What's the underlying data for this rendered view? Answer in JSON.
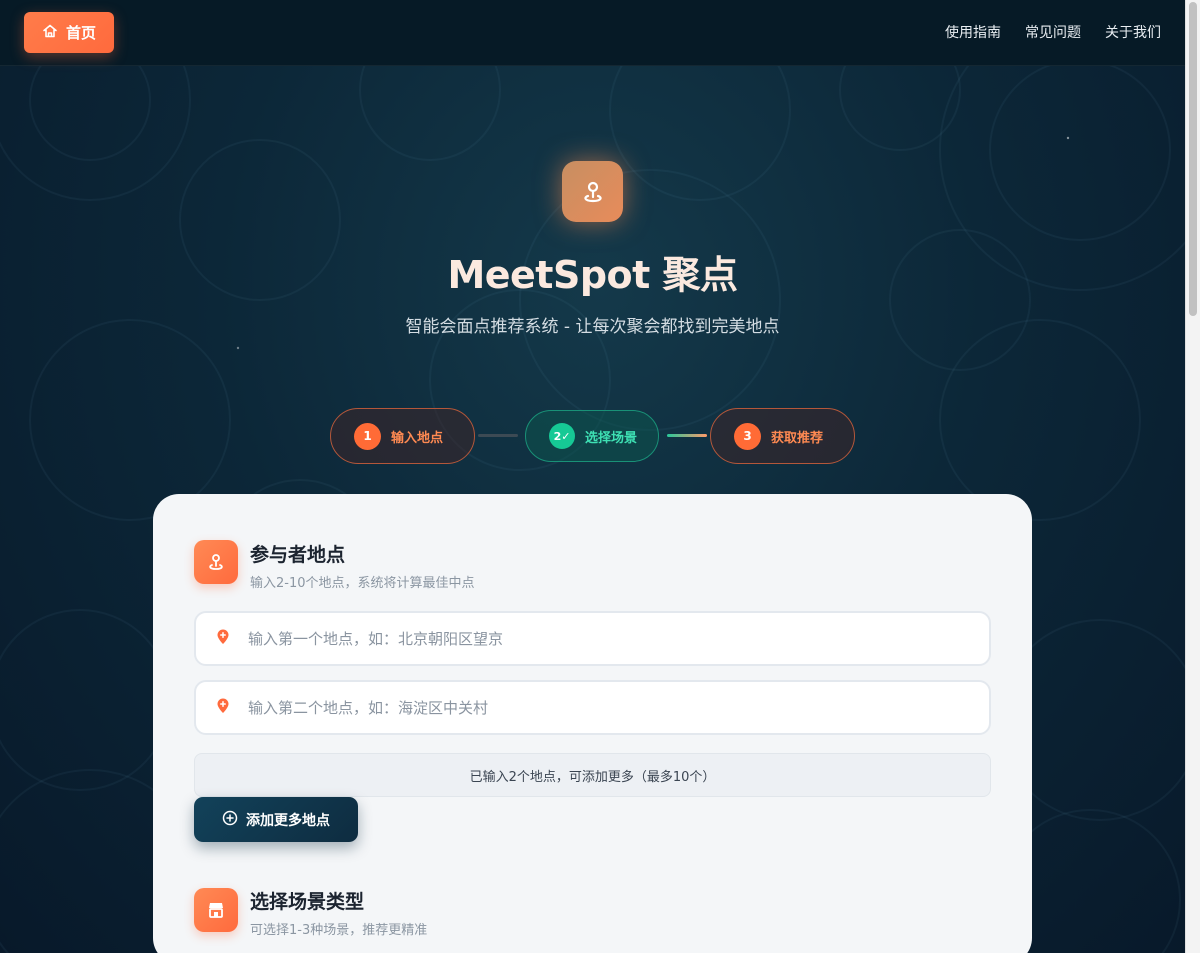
{
  "nav": {
    "home_label": "首页",
    "links": [
      "使用指南",
      "常见问题",
      "关于我们"
    ]
  },
  "hero": {
    "title": "MeetSpot 聚点",
    "subtitle": "智能会面点推荐系统 - 让每次聚会都找到完美地点"
  },
  "steps": [
    {
      "num": "1",
      "label": "输入地点",
      "state": "pending"
    },
    {
      "num": "2✓",
      "label": "选择场景",
      "state": "active"
    },
    {
      "num": "3",
      "label": "获取推荐",
      "state": "pending"
    }
  ],
  "participants": {
    "title": "参与者地点",
    "desc": "输入2-10个地点，系统将计算最佳中点",
    "inputs": [
      {
        "value": "",
        "placeholder": "输入第一个地点，如：北京朝阳区望京"
      },
      {
        "value": "",
        "placeholder": "输入第二个地点，如：海淀区中关村"
      }
    ],
    "count_text": "已输入2个地点，可添加更多（最多10个）",
    "add_label": "添加更多地点"
  },
  "scene": {
    "title": "选择场景类型",
    "desc": "可选择1-3种场景，推荐更精准"
  },
  "colors": {
    "accent_orange": "#ff6a3d",
    "accent_teal": "#16c995",
    "navy": "#0e2c40"
  },
  "icons": {
    "home": "home-icon",
    "logo": "location-pin-icon",
    "input_pin": "map-pin-icon",
    "add": "plus-circle-icon",
    "scene": "storefront-icon"
  }
}
